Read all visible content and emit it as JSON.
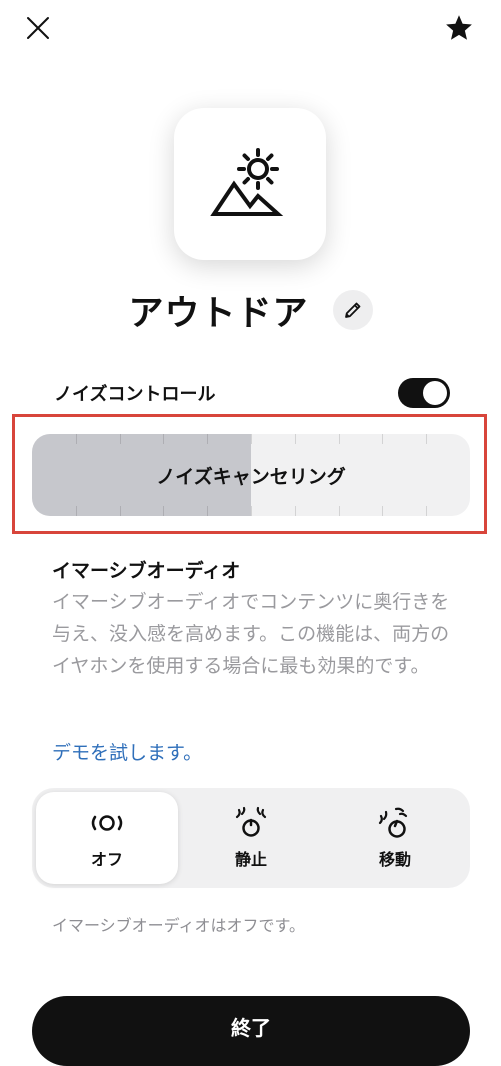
{
  "header": {
    "close_icon": "close-icon",
    "favorite_icon": "star-icon"
  },
  "mode": {
    "icon": "sun-mountain-icon",
    "title": "アウトドア",
    "edit_icon": "pencil-icon"
  },
  "noise_control": {
    "label": "ノイズコントロール",
    "enabled": true,
    "slider_label": "ノイズキャンセリング",
    "level": 0.5
  },
  "immersive_audio": {
    "heading": "イマーシブオーディオ",
    "description": "イマーシブオーディオでコンテンツに奥行きを与え、没入感を高めます。この機能は、両方のイヤホンを使用する場合に最も効果的です。",
    "demo_link": "デモを試します。",
    "options": [
      {
        "label": "オフ",
        "icon": "audio-off-icon",
        "selected": true
      },
      {
        "label": "静止",
        "icon": "head-still-icon",
        "selected": false
      },
      {
        "label": "移動",
        "icon": "head-tracking-icon",
        "selected": false
      }
    ],
    "status": "イマーシブオーディオはオフです。"
  },
  "footer": {
    "done_label": "終了"
  },
  "colors": {
    "highlight": "#d8453b",
    "link": "#2f6fba",
    "toggle_on": "#111111"
  }
}
